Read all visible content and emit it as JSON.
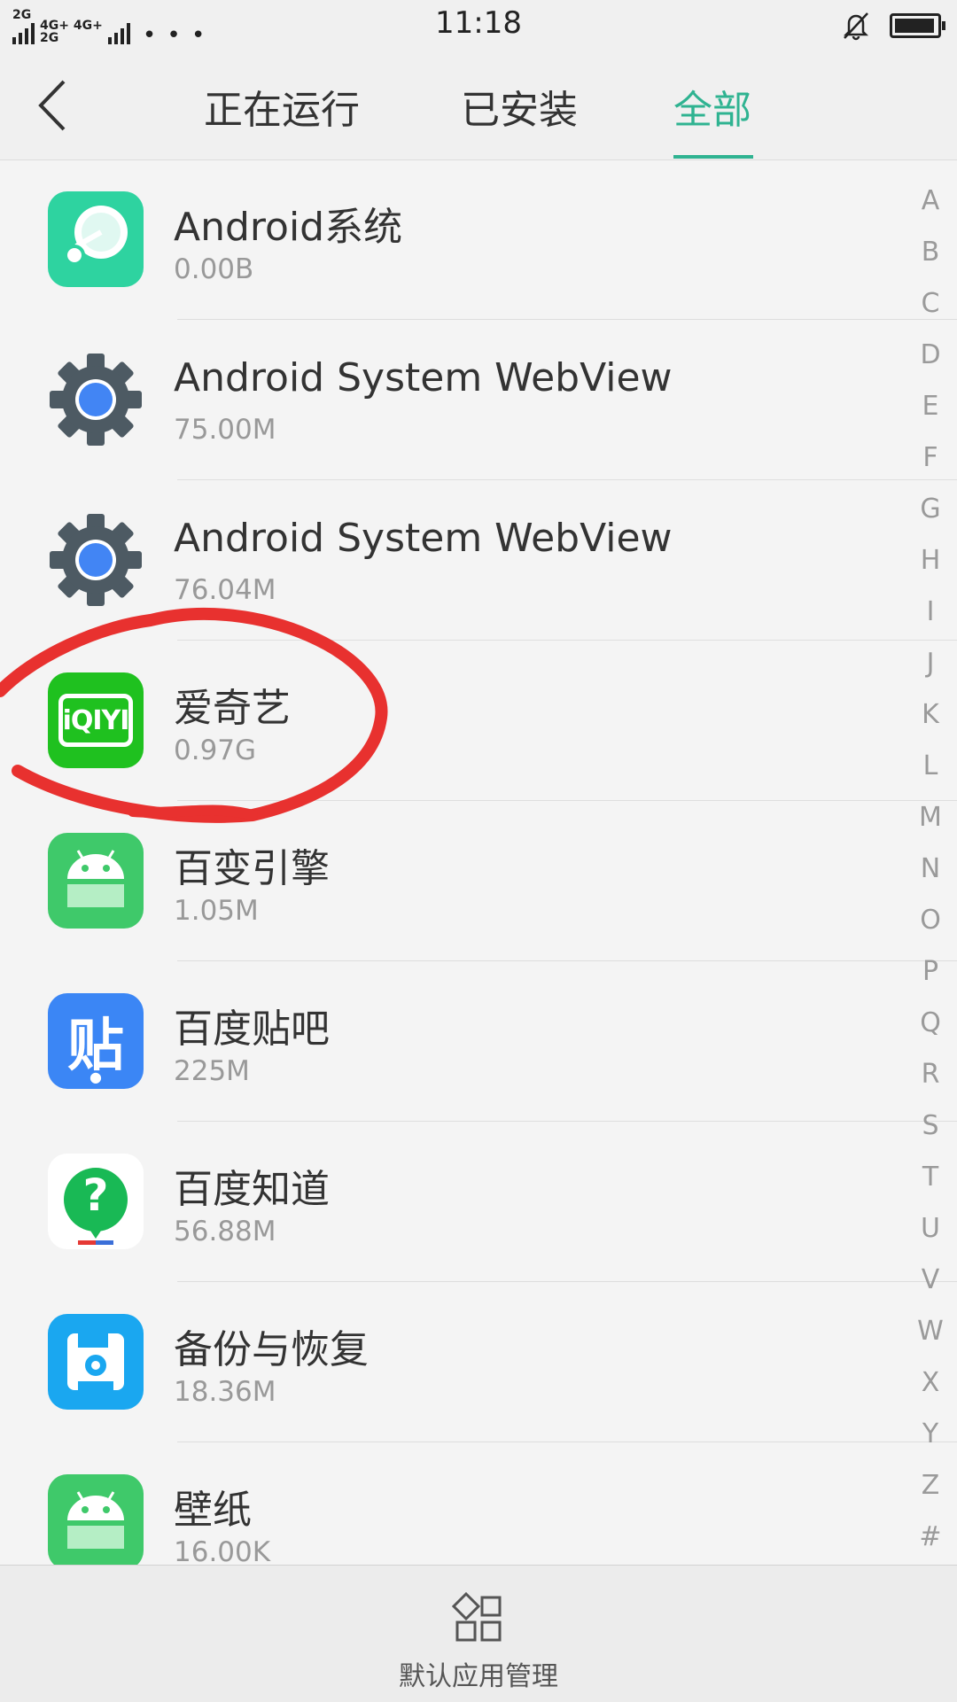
{
  "status": {
    "time": "11:18",
    "net1": "2G",
    "net2": "4G+ 4G+",
    "net3": "2G",
    "dots": "• • •"
  },
  "tabs": [
    {
      "label": "正在运行"
    },
    {
      "label": "已安装"
    },
    {
      "label": "全部"
    }
  ],
  "active_tab": "全部",
  "accent_color": "#2fb391",
  "apps": [
    {
      "name": "Android系统",
      "size": "0.00B",
      "icon": "android-system-icon"
    },
    {
      "name": "Android System WebView",
      "size": "75.00M",
      "icon": "webview-gear-icon"
    },
    {
      "name": "Android System WebView",
      "size": "76.04M",
      "icon": "webview-gear-icon"
    },
    {
      "name": "爱奇艺",
      "size": "0.97G",
      "icon": "iqiyi-icon",
      "icon_text": "iQIYI"
    },
    {
      "name": "百变引擎",
      "size": "1.05M",
      "icon": "android-robot-icon"
    },
    {
      "name": "百度贴吧",
      "size": "225M",
      "icon": "baidu-tieba-icon",
      "icon_text": "贴"
    },
    {
      "name": "百度知道",
      "size": "56.88M",
      "icon": "baidu-zhidao-icon",
      "icon_text": "?"
    },
    {
      "name": "备份与恢复",
      "size": "18.36M",
      "icon": "backup-restore-icon"
    },
    {
      "name": "壁纸",
      "size": "16.00K",
      "icon": "android-robot-icon"
    }
  ],
  "index_letters": [
    "A",
    "B",
    "C",
    "D",
    "E",
    "F",
    "G",
    "H",
    "I",
    "J",
    "K",
    "L",
    "M",
    "N",
    "O",
    "P",
    "Q",
    "R",
    "S",
    "T",
    "U",
    "V",
    "W",
    "X",
    "Y",
    "Z",
    "#"
  ],
  "bottom": {
    "label": "默认应用管理",
    "icon": "apps-grid-icon"
  }
}
